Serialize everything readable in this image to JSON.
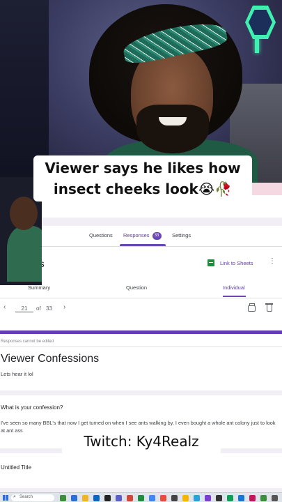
{
  "overlay": {
    "caption": "Viewer says he likes how insect cheeks look😭🥀",
    "twitch": "Twitch: Ky4Realz"
  },
  "forms": {
    "tabs": [
      {
        "label": "Questions"
      },
      {
        "label": "Responses",
        "badge": "33"
      },
      {
        "label": "Settings"
      }
    ],
    "header_title": "nses",
    "sheets_link": "Link to Sheets",
    "subtabs": [
      "Summary",
      "Question",
      "Individual"
    ],
    "active_subtab": "Individual",
    "pager": {
      "current": "21",
      "of": "of",
      "total": "33"
    },
    "not_editable_note": "Responses cannot be edited",
    "form_title": "Viewer Confessions",
    "form_description": "Lets hear it lol",
    "question": "What is your confession?",
    "answer": "I've seen so many BBL's that now I get turned on when I see ants walking by, I even bought a whole ant colony just to look at ant ass",
    "untitled": "Untitled Title"
  },
  "taskbar": {
    "search_label": "Search",
    "icon_colors": [
      "#3c8f3a",
      "#2b6fd6",
      "#f0b429",
      "#0a66c2",
      "#222222",
      "#5b5fc7",
      "#d44638",
      "#1e8e3e",
      "#4285f4",
      "#e74c3c",
      "#444444",
      "#f7b500",
      "#2aa1da",
      "#7a3fd1",
      "#333333",
      "#0f9d58",
      "#1976d2",
      "#c2185b",
      "#3c8f3a",
      "#555555"
    ]
  },
  "colors": {
    "accent": "#673ab7",
    "sheets_green": "#1e8e3e"
  }
}
